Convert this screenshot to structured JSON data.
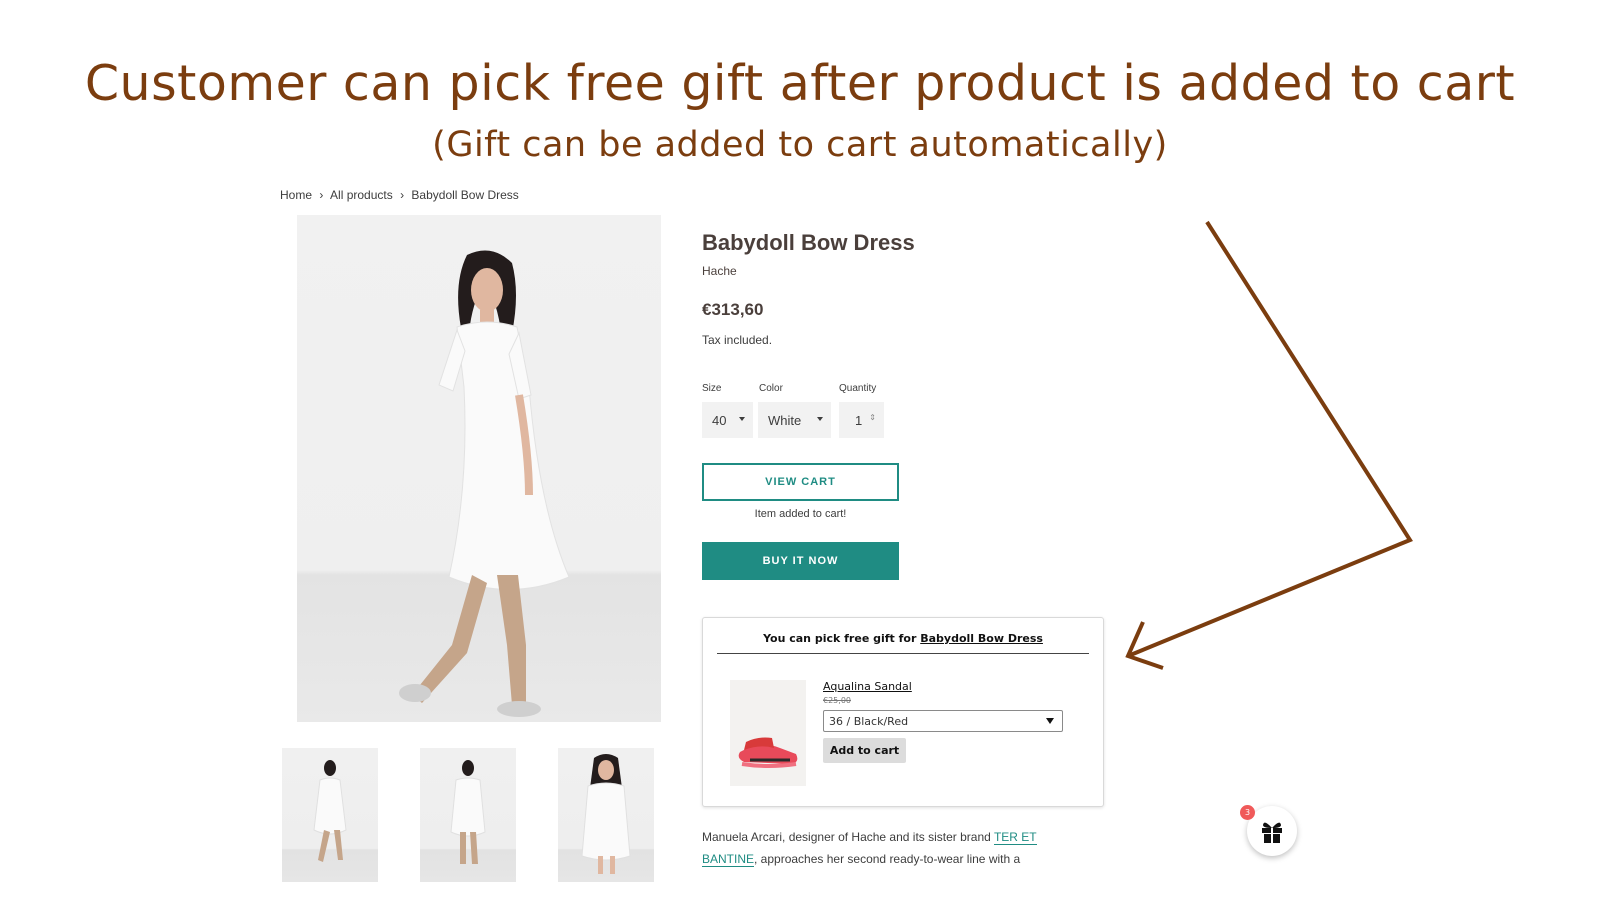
{
  "caption": {
    "title": "Customer can pick free gift after product is added to cart",
    "subtitle": "(Gift can be added to cart automatically)"
  },
  "breadcrumb": [
    {
      "label": "Home"
    },
    {
      "label": "›"
    },
    {
      "label": "All products"
    },
    {
      "label": "›"
    },
    {
      "label": "Babydoll Bow Dress"
    }
  ],
  "product": {
    "title": "Babydoll Bow Dress",
    "vendor": "Hache",
    "price": "€313,60",
    "tax_note": "Tax included.",
    "options": {
      "size_label": "Size",
      "size_value": "40",
      "color_label": "Color",
      "color_value": "White",
      "quantity_label": "Quantity",
      "quantity_value": "1"
    },
    "view_cart_label": "VIEW CART",
    "added_message": "Item added to cart!",
    "buy_now_label": "BUY IT NOW",
    "description_text": "Manuela Arcari, designer of Hache and its sister brand ",
    "description_link": "TER ET BANTINE",
    "description_tail": ", approaches her second ready-to-wear line with a"
  },
  "gift_panel": {
    "heading_prefix": "You can pick free gift for ",
    "heading_product": "Babydoll Bow Dress",
    "item_name": "Aqualina Sandal",
    "item_old_price": "€25,00",
    "variant_value": "36 / Black/Red",
    "add_label": "Add to cart"
  },
  "gift_widget": {
    "badge_count": "3",
    "icon": "gift-icon"
  },
  "colors": {
    "accent": "#1f8c83",
    "caption": "#7b3d0f",
    "badge": "#f05a5a"
  }
}
